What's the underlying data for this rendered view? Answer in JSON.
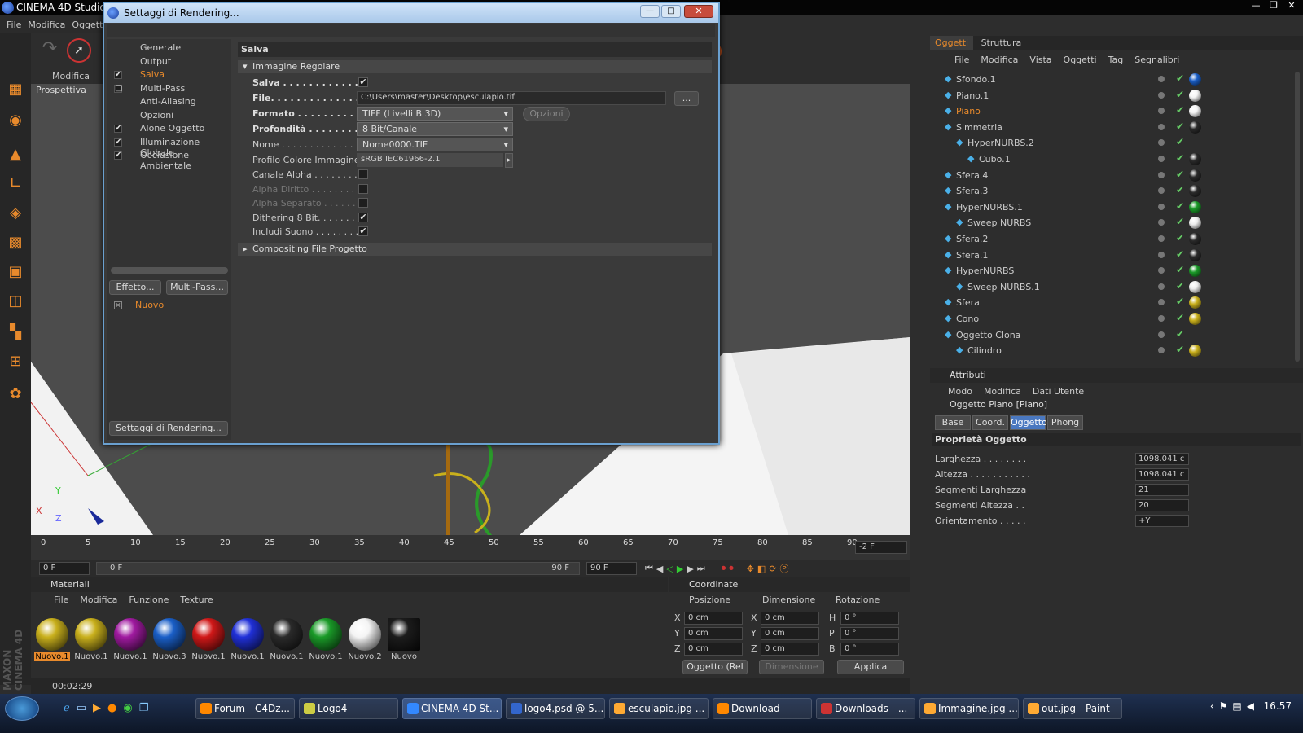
{
  "app": {
    "title": "CINEMA 4D Studio",
    "menu": [
      "File",
      "Modifica",
      "Oggetti"
    ]
  },
  "viewport": {
    "menu": "Modifica",
    "label": "Prospettiva",
    "axes": {
      "x": "X",
      "y": "Y",
      "z": "Z"
    }
  },
  "timeline": {
    "ticks": [
      "0",
      "5",
      "10",
      "15",
      "20",
      "25",
      "30",
      "35",
      "40",
      "45",
      "50",
      "55",
      "60",
      "65",
      "70",
      "75",
      "80",
      "85",
      "90"
    ],
    "current": "-2 F",
    "start": "0 F",
    "range_start": "0 F",
    "range_end": "90 F",
    "end": "90 F"
  },
  "materials": {
    "title": "Materiali",
    "menu": [
      "File",
      "Modifica",
      "Funzione",
      "Texture"
    ],
    "items": [
      {
        "name": "Nuovo.1",
        "color": "#c9b01c"
      },
      {
        "name": "Nuovo.1",
        "color": "#c9b01c"
      },
      {
        "name": "Nuovo.1",
        "color": "#a01aa0"
      },
      {
        "name": "Nuovo.3",
        "color": "#1a5fc8"
      },
      {
        "name": "Nuovo.1",
        "color": "#d01818"
      },
      {
        "name": "Nuovo.1",
        "color": "#2030d8"
      },
      {
        "name": "Nuovo.1",
        "color": "#2a2a2a"
      },
      {
        "name": "Nuovo.1",
        "color": "#1a9a28"
      },
      {
        "name": "Nuovo.2",
        "color": "#f4f4f4"
      },
      {
        "name": "Nuovo",
        "color": "#1c1c1c"
      }
    ]
  },
  "coordinates": {
    "title": "Coordinate",
    "cols": [
      "Posizione",
      "Dimensione",
      "Rotazione"
    ],
    "rows": [
      {
        "a": "X",
        "p": "0 cm",
        "b": "X",
        "d": "0 cm",
        "c": "H",
        "r": "0 °"
      },
      {
        "a": "Y",
        "p": "0 cm",
        "b": "Y",
        "d": "0 cm",
        "c": "P",
        "r": "0 °"
      },
      {
        "a": "Z",
        "p": "0 cm",
        "b": "Z",
        "d": "0 cm",
        "c": "B",
        "r": "0 °"
      }
    ],
    "mode": "Oggetto (Rel",
    "dim": "Dimensione",
    "apply": "Applica"
  },
  "status": {
    "time": "00:02:29"
  },
  "objects": {
    "tabs": [
      "Oggetti",
      "Struttura"
    ],
    "menu": [
      "File",
      "Modifica",
      "Vista",
      "Oggetti",
      "Tag",
      "Segnalibri"
    ],
    "items": [
      {
        "name": "Sfondo.1",
        "indent": 0,
        "active": false,
        "tag": "#1a5fc8"
      },
      {
        "name": "Piano.1",
        "indent": 0,
        "active": false,
        "tag": "#f4f4f4"
      },
      {
        "name": "Piano",
        "indent": 0,
        "active": true,
        "tag": "#f4f4f4"
      },
      {
        "name": "Simmetria",
        "indent": 0,
        "active": false,
        "tag": "#2a2a2a"
      },
      {
        "name": "HyperNURBS.2",
        "indent": 1,
        "active": false,
        "tag": ""
      },
      {
        "name": "Cubo.1",
        "indent": 2,
        "active": false,
        "tag": "#2a2a2a"
      },
      {
        "name": "Sfera.4",
        "indent": 0,
        "active": false,
        "tag": "#2a2a2a"
      },
      {
        "name": "Sfera.3",
        "indent": 0,
        "active": false,
        "tag": "#2a2a2a"
      },
      {
        "name": "HyperNURBS.1",
        "indent": 0,
        "active": false,
        "tag": "#1a9a28"
      },
      {
        "name": "Sweep NURBS",
        "indent": 1,
        "active": false,
        "tag": "#eeeeee"
      },
      {
        "name": "Sfera.2",
        "indent": 0,
        "active": false,
        "tag": "#2a2a2a"
      },
      {
        "name": "Sfera.1",
        "indent": 0,
        "active": false,
        "tag": "#2a2a2a"
      },
      {
        "name": "HyperNURBS",
        "indent": 0,
        "active": false,
        "tag": "#1a9a28"
      },
      {
        "name": "Sweep NURBS.1",
        "indent": 1,
        "active": false,
        "tag": "#eeeeee"
      },
      {
        "name": "Sfera",
        "indent": 0,
        "active": false,
        "tag": "#c9b01c"
      },
      {
        "name": "Cono",
        "indent": 0,
        "active": false,
        "tag": "#c9b01c"
      },
      {
        "name": "Oggetto Clona",
        "indent": 0,
        "active": false,
        "tag": ""
      },
      {
        "name": "Cilindro",
        "indent": 1,
        "active": false,
        "tag": "#c9b01c"
      }
    ]
  },
  "attributes": {
    "title": "Attributi",
    "menu": [
      "Modo",
      "Modifica",
      "Dati Utente"
    ],
    "object": "Oggetto Piano [Piano]",
    "tabs": [
      "Base",
      "Coord.",
      "Oggetto",
      "Phong"
    ],
    "active_tab": "Oggetto",
    "section": "Proprietà Oggetto",
    "props": [
      {
        "label": "Larghezza . . . . . . . .",
        "value": "1098.041 c"
      },
      {
        "label": "Altezza . . . . . . . . . . .",
        "value": "1098.041 c"
      },
      {
        "label": "Segmenti Larghezza",
        "value": "21"
      },
      {
        "label": "Segmenti Altezza . .",
        "value": "20"
      },
      {
        "label": "Orientamento . . . . .",
        "value": "+Y"
      }
    ]
  },
  "dialog": {
    "title": "Settaggi di Rendering...",
    "tree": [
      {
        "label": "Generale",
        "check": ""
      },
      {
        "label": "Output",
        "check": ""
      },
      {
        "label": "Salva",
        "check": "✔"
      },
      {
        "label": "Multi-Pass",
        "check": "□"
      },
      {
        "label": "Anti-Aliasing",
        "check": ""
      },
      {
        "label": "Opzioni",
        "check": ""
      },
      {
        "label": "Alone Oggetto",
        "check": "✔"
      },
      {
        "label": "Illuminazione Globale",
        "check": "✔"
      },
      {
        "label": "Occlusione Ambientale",
        "check": "✔"
      }
    ],
    "effect_btn": "Effetto...",
    "multipass_btn": "Multi-Pass...",
    "preset": "Nuovo",
    "footer_btn": "Settaggi di Rendering...",
    "panel_title": "Salva",
    "section1": "Immagine Regolare",
    "section2": "Compositing File Progetto",
    "save_label": "Salva . . . . . . . . . . . . .",
    "file_label": "File. . . . . . . . . . . . . . .",
    "file_value": "C:\\Users\\master\\Desktop\\esculapio.tif",
    "browse": "...",
    "format_label": "Formato . . . . . . . . . . .",
    "format_value": "TIFF (Livelli  B 3D)",
    "options_btn": "Opzioni",
    "depth_label": "Profondità . . . . . . . .",
    "depth_value": "8 Bit/Canale",
    "name_label": "Nome . . . . . . . . . . . . . . .",
    "name_value": "Nome0000.TIF",
    "profile_label": "Profilo Colore Immagine",
    "profile_value": "sRGB IEC61966-2.1",
    "checks": [
      {
        "label": "Canale Alpha . . . . . . . . .",
        "checked": ""
      },
      {
        "label": "Alpha Diritto . . . . . . . .",
        "checked": ""
      },
      {
        "label": "Alpha Separato . . . . . . .",
        "checked": ""
      },
      {
        "label": "Dithering 8 Bit. . . . . . . .",
        "checked": "✔"
      },
      {
        "label": "Includi Suono . . . . . . . .",
        "checked": "✔"
      }
    ]
  },
  "taskbar": {
    "items": [
      "Forum - C4Dz...",
      "Logo4",
      "CINEMA 4D St...",
      "logo4.psd @ 5...",
      "esculapio.jpg ...",
      "Download",
      "Downloads - ...",
      "Immagine.jpg ...",
      "out.jpg - Paint"
    ],
    "clock": "16.57"
  }
}
